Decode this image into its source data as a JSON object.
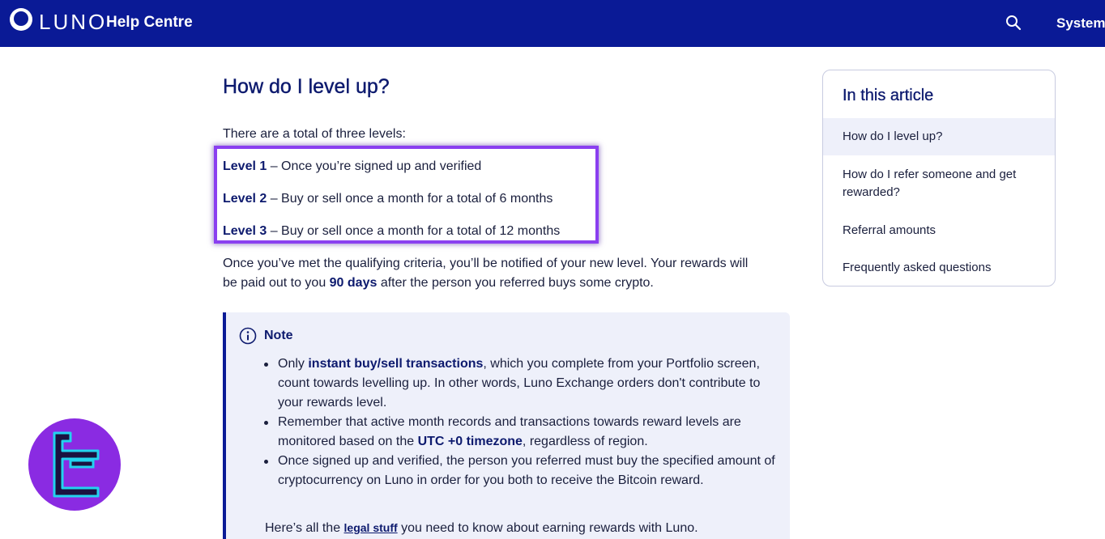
{
  "header": {
    "logo_text": "LUNO",
    "section_title": "Help Centre",
    "search_icon": "search-icon",
    "system_label": "System"
  },
  "article": {
    "title": "How do I level up?",
    "intro": "There are a total of three levels:",
    "levels": [
      {
        "label": "Level 1",
        "text": " – Once you’re signed up and verified"
      },
      {
        "label": "Level 2",
        "text": " – Buy or sell once a month for a total of 6 months"
      },
      {
        "label": "Level 3",
        "text": " – Buy or sell once a month for a total of 12 months"
      }
    ],
    "criteria_line1": "Once you’ve met the qualifying criteria, you’ll be notified of your new level. Your rewards will",
    "criteria_line2_before": "be paid out to you ",
    "criteria_line2_bold": "90 days",
    "criteria_line2_after": " after the person you referred buys some crypto."
  },
  "note": {
    "icon": "info-icon",
    "title": "Note",
    "bullet1_before": "Only ",
    "bullet1_bold": "instant buy/sell transactions",
    "bullet1_after": ", which you complete from your Portfolio screen, count towards levelling up. In other words, Luno Exchange orders don't contribute to your rewards level.",
    "bullet2_before": "Remember that active month records and transactions towards reward levels are monitored based on the ",
    "bullet2_bold": "UTC +0 timezone",
    "bullet2_after": ", regardless of region.",
    "bullet3": "Once signed up and verified, the person you referred must buy the specified amount of cryptocurrency on Luno in order for you both to receive the Bitcoin reward.",
    "footer_before": "Here’s all the ",
    "footer_link": "legal stuff",
    "footer_after": " you need to know about earning rewards with Luno."
  },
  "toc": {
    "title": "In this article",
    "items": [
      "How do I level up?",
      "How do I refer someone and get rewarded?",
      "Referral amounts",
      "Frequently asked questions"
    ]
  },
  "badge": {
    "icon": "tc-logo-icon"
  },
  "colors": {
    "header_bg": "#0a1a96",
    "highlight": "#8a3ff0",
    "note_bg": "#eef0fa",
    "badge_bg": "#8a2be2",
    "badge_glyph": "#22d3ee"
  }
}
